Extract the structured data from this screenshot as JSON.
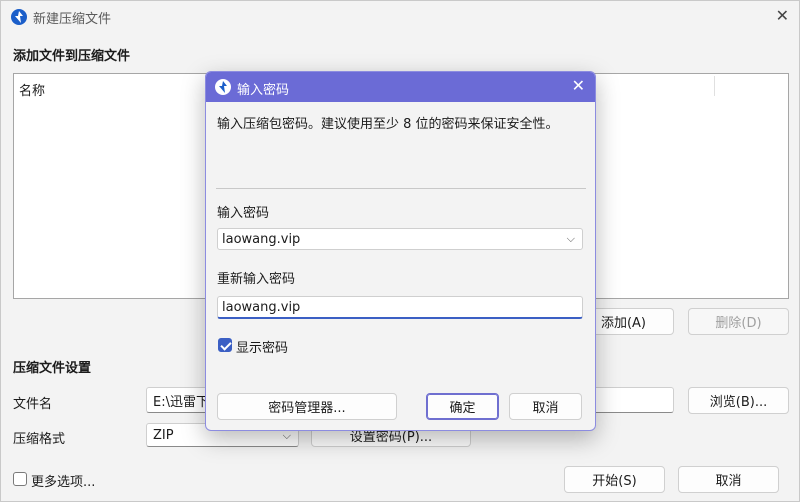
{
  "main_window": {
    "title": "新建压缩文件",
    "add_section_title": "添加文件到压缩文件",
    "list_header_name": "名称",
    "add_button": "添加(A)",
    "delete_button": "删除(D)",
    "settings_section_title": "压缩文件设置",
    "filename_label": "文件名",
    "filename_value": "E:\\迅雷下",
    "browse_button": "浏览(B)...",
    "format_label": "压缩格式",
    "format_value": "ZIP",
    "set_password_button": "设置密码(P)...",
    "more_options_label": "更多选项...",
    "start_button": "开始(S)",
    "cancel_button": "取消"
  },
  "dialog": {
    "title": "输入密码",
    "description": "输入压缩包密码。建议使用至少 8 位的密码来保证安全性。",
    "password_label": "输入密码",
    "password_value": "laowang.vip",
    "reenter_label": "重新输入密码",
    "reenter_value": "laowang.vip",
    "show_password_label": "显示密码",
    "show_password_checked": true,
    "password_manager_button": "密码管理器...",
    "ok_button": "确定",
    "cancel_button": "取消"
  },
  "icons": {
    "app": "app-logo-icon",
    "close": "close-icon",
    "dropdown": "chevron-down-icon",
    "check": "checkmark-icon"
  },
  "colors": {
    "accent": "#6b6bd6",
    "focus": "#3b5fc4",
    "window_bg": "#f3f3f3"
  }
}
